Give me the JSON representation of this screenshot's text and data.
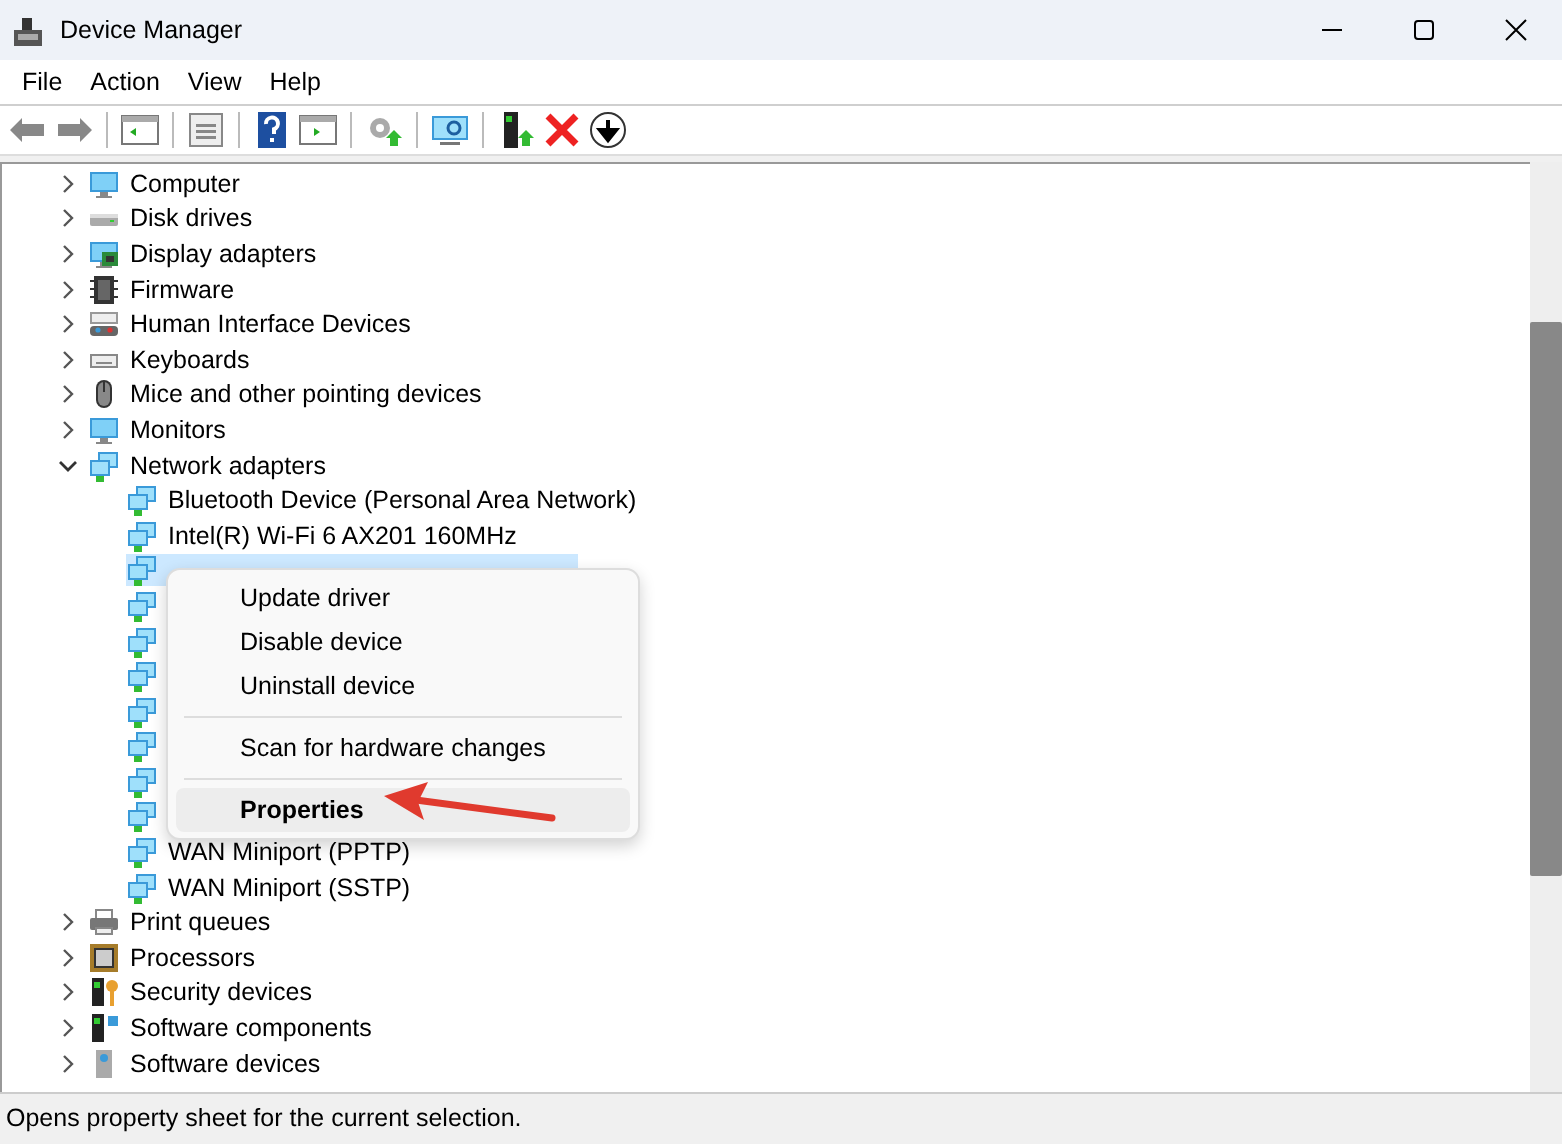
{
  "window": {
    "title": "Device Manager"
  },
  "menu_bar": [
    "File",
    "Action",
    "View",
    "Help"
  ],
  "toolbar": [
    {
      "kind": "back"
    },
    {
      "kind": "forward"
    },
    {
      "kind": "sep"
    },
    {
      "kind": "tree"
    },
    {
      "kind": "sep"
    },
    {
      "kind": "sheet"
    },
    {
      "kind": "sep"
    },
    {
      "kind": "help"
    },
    {
      "kind": "panel"
    },
    {
      "kind": "sep"
    },
    {
      "kind": "update"
    },
    {
      "kind": "sep"
    },
    {
      "kind": "scan"
    },
    {
      "kind": "sep"
    },
    {
      "kind": "enable"
    },
    {
      "kind": "remove"
    },
    {
      "kind": "down"
    }
  ],
  "tree": [
    {
      "label": "Computer",
      "kind": "computer",
      "expanded": false
    },
    {
      "label": "Disk drives",
      "kind": "disk",
      "expanded": false
    },
    {
      "label": "Display adapters",
      "kind": "display",
      "expanded": false
    },
    {
      "label": "Firmware",
      "kind": "chip",
      "expanded": false
    },
    {
      "label": "Human Interface Devices",
      "kind": "hid",
      "expanded": false
    },
    {
      "label": "Keyboards",
      "kind": "keyboard",
      "expanded": false
    },
    {
      "label": "Mice and other pointing devices",
      "kind": "mouse",
      "expanded": false
    },
    {
      "label": "Monitors",
      "kind": "monitor",
      "expanded": false
    },
    {
      "label": "Network adapters",
      "kind": "network",
      "expanded": true,
      "children": [
        {
          "label": "Bluetooth Device (Personal Area Network)",
          "kind": "network",
          "selected": false
        },
        {
          "label": "Intel(R) Wi-Fi 6 AX201 160MHz",
          "kind": "network",
          "selected": false
        },
        {
          "kind": "network",
          "selected": true
        },
        {
          "kind": "network",
          "selected": false
        },
        {
          "kind": "network",
          "selected": false
        },
        {
          "kind": "network",
          "selected": false
        },
        {
          "kind": "network",
          "selected": false
        },
        {
          "kind": "network",
          "selected": false
        },
        {
          "kind": "network",
          "selected": false
        },
        {
          "kind": "network",
          "selected": false
        },
        {
          "label": "WAN Miniport (PPTP)",
          "kind": "network",
          "selected": false
        },
        {
          "label": "WAN Miniport (SSTP)",
          "kind": "network",
          "selected": false
        }
      ]
    },
    {
      "label": "Print queues",
      "kind": "printer",
      "expanded": false
    },
    {
      "label": "Processors",
      "kind": "processor",
      "expanded": false
    },
    {
      "label": "Security devices",
      "kind": "security",
      "expanded": false
    },
    {
      "label": "Software components",
      "kind": "software",
      "expanded": false
    },
    {
      "label": "Software devices",
      "kind": "softdev",
      "expanded": false
    }
  ],
  "context_menu": [
    {
      "kind": "item",
      "label": "Update driver",
      "selected": false,
      "default": false
    },
    {
      "kind": "item",
      "label": "Disable device",
      "selected": false,
      "default": false
    },
    {
      "kind": "item",
      "label": "Uninstall device",
      "selected": false,
      "default": false
    },
    {
      "kind": "separator"
    },
    {
      "kind": "item",
      "label": "Scan for hardware changes",
      "selected": false,
      "default": false
    },
    {
      "kind": "separator"
    },
    {
      "kind": "item",
      "label": "Properties",
      "selected": true,
      "default": true
    }
  ],
  "status_bar": "Opens property sheet for the current selection."
}
